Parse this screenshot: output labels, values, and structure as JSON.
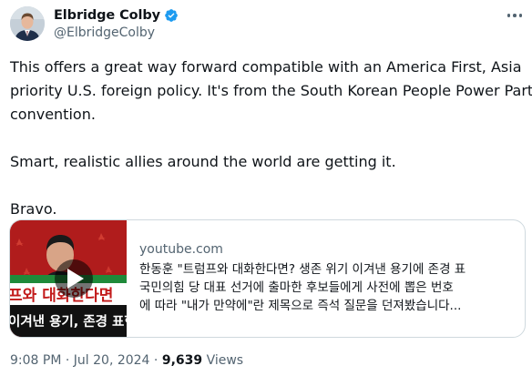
{
  "author": {
    "name": "Elbridge Colby",
    "handle": "@ElbridgeColby",
    "verified": true,
    "avatar_icon": "profile-photo"
  },
  "tweet": {
    "lines": [
      "This offers a great way forward compatible with an America First, Asia",
      "priority U.S. foreign policy. It's from the South Korean People Power Party",
      "convention."
    ],
    "line2": "Smart, realistic allies around the world are getting it.",
    "line3": "Bravo."
  },
  "card": {
    "domain": "youtube.com",
    "title": "한동훈 \"트럼프와 대화한다면? 생존 위기 이겨낸 용기에 존경 표",
    "desc_lines": [
      "국민의힘 당 대표 선거에 출마한 후보들에게 사전에 뽑은 번호",
      "에 따라 \"내가 만약에\"란 제목으로 즉석 질문을 던져봤습니다..."
    ],
    "thumb_caption_1": "프와 대화한다면",
    "thumb_caption_2": "이겨낸 용기, 존경 표현"
  },
  "meta": {
    "time": "9:08 PM",
    "separator": "·",
    "date": "Jul 20, 2024",
    "views_count": "9,639",
    "views_label": "Views"
  },
  "colors": {
    "verified": "#1d9bf0",
    "secondary_text": "#536471",
    "thumb_red": "#b21f1f",
    "border": "#cfd9de"
  }
}
